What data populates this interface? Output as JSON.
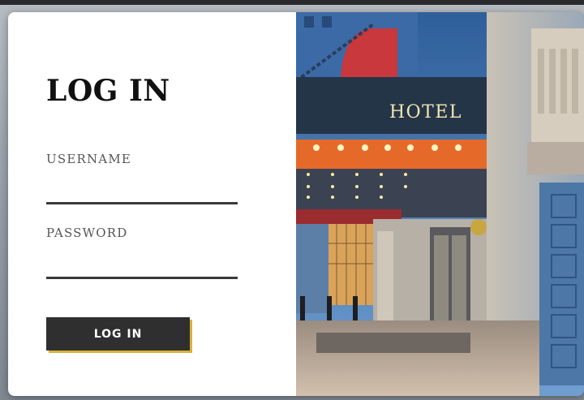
{
  "login": {
    "title": "LOG IN",
    "username_label": "USERNAME",
    "username_value": "",
    "password_label": "PASSWORD",
    "password_value": "",
    "submit_label": "LOG IN"
  },
  "photo": {
    "sign_text": "HOTEL"
  },
  "colors": {
    "button_bg": "#2f2f2f",
    "button_accent": "#d8b23a",
    "field_underline": "#3a3a3a"
  }
}
